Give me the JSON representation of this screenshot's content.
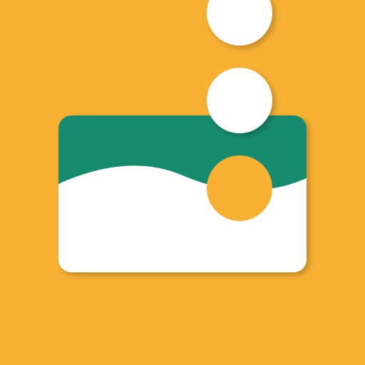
{
  "icon": {
    "semantic": "app-launcher-icon",
    "motif": "landscape-card-with-dots",
    "colors": {
      "background": "#F8B133",
      "card_sky": "#178B70",
      "card_ground": "#FFFFFF",
      "dot_white": "#FFFFFF",
      "dot_inner": "#F8B133",
      "shadow": "#000000"
    }
  }
}
